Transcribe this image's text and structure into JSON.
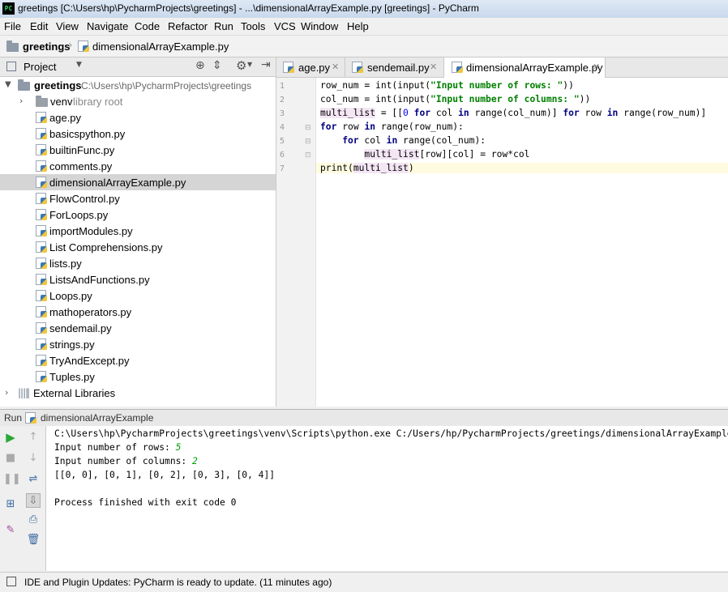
{
  "window": {
    "title": "greetings [C:\\Users\\hp\\PycharmProjects\\greetings] - ...\\dimensionalArrayExample.py [greetings] - PyCharm",
    "app_icon_text": "PC"
  },
  "menu": [
    "File",
    "Edit",
    "View",
    "Navigate",
    "Code",
    "Refactor",
    "Run",
    "Tools",
    "VCS",
    "Window",
    "Help"
  ],
  "breadcrumb": {
    "project": "greetings",
    "file": "dimensionalArrayExample.py"
  },
  "project_panel": {
    "title": "Project",
    "root_name": "greetings",
    "root_path": "C:\\Users\\hp\\PycharmProjects\\greetings",
    "venv_name": "venv",
    "venv_note": "library root",
    "files": [
      "age.py",
      "basicspython.py",
      "builtinFunc.py",
      "comments.py",
      "dimensionalArrayExample.py",
      "FlowControl.py",
      "ForLoops.py",
      "importModules.py",
      "List Comprehensions.py",
      "lists.py",
      "ListsAndFunctions.py",
      "Loops.py",
      "mathoperators.py",
      "sendemail.py",
      "strings.py",
      "TryAndExcept.py",
      "Tuples.py"
    ],
    "selected_file": "dimensionalArrayExample.py",
    "external": "External Libraries"
  },
  "tabs": [
    "age.py",
    "sendemail.py",
    "dimensionalArrayExample.py"
  ],
  "line_numbers": [
    "1",
    "2",
    "3",
    "4",
    "5",
    "6",
    "7"
  ],
  "code": {
    "l1": {
      "a": "row_num = ",
      "b": "int",
      "c": "(input(",
      "d": "\"Input number of rows: \"",
      "e": "))"
    },
    "l2": {
      "a": "col_num = ",
      "b": "int",
      "c": "(input(",
      "d": "\"Input number of columns: \"",
      "e": "))"
    },
    "l3": {
      "a": "multi_list",
      "b": " = [[",
      "c": "0",
      "d": " for ",
      "e": "col ",
      "f": "in ",
      "g": "range(col_num)] ",
      "h": "for ",
      "i": "row ",
      "j": "in ",
      "k": "range(row_num)]"
    },
    "l4": {
      "a": "for ",
      "b": "row ",
      "c": "in ",
      "d": "range(row_num):"
    },
    "l5": {
      "a": "    for ",
      "b": "col ",
      "c": "in ",
      "d": "range(col_num):"
    },
    "l6": {
      "a": "        ",
      "b": "multi_list",
      "c": "[row][col] = row*col"
    },
    "l7": {
      "a": "print(",
      "b": "multi_list",
      "c": ")"
    }
  },
  "run": {
    "label": "Run",
    "config": "dimensionalArrayExample",
    "cmd": "C:\\Users\\hp\\PycharmProjects\\greetings\\venv\\Scripts\\python.exe C:/Users/hp/PycharmProjects/greetings/dimensionalArrayExample.py",
    "prompt_rows": "Input number of rows: ",
    "rows_value": "5",
    "prompt_cols": "Input number of columns: ",
    "cols_value": "2",
    "result": "[[0, 0], [0, 1], [0, 2], [0, 3], [0, 4]]",
    "exit": "Process finished with exit code 0"
  },
  "status": "IDE and Plugin Updates: PyCharm is ready to update. (11 minutes ago)"
}
